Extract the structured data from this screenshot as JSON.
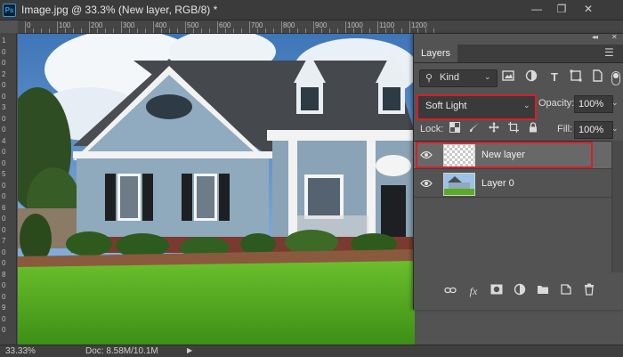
{
  "document": {
    "title": "Image.jpg @ 33.3% (New layer, RGB/8) *",
    "ps_logo": "Ps"
  },
  "window": {
    "minimize": "—",
    "restore": "❐",
    "close": "✕"
  },
  "ruler": {
    "horizontal_labels": [
      "0",
      "100",
      "200",
      "300",
      "400",
      "500",
      "600",
      "700",
      "800",
      "900",
      "1000",
      "1100",
      "1200"
    ],
    "vertical_labels": [
      "1",
      "0",
      "0",
      "2",
      "0",
      "0",
      "3",
      "0",
      "0",
      "4",
      "0",
      "0",
      "5",
      "0",
      "0",
      "6",
      "0",
      "0",
      "7",
      "0",
      "0",
      "8",
      "0",
      "0",
      "9",
      "0",
      "0"
    ]
  },
  "status": {
    "zoom": "33.33%",
    "doc": "Doc: 8.58M/10.1M",
    "arrow": "▶"
  },
  "layers_panel": {
    "collapse_icon": "◂◂",
    "close_icon": "✕",
    "tab_label": "Layers",
    "menu_icon": "☰",
    "filter": {
      "search_icon": "⚲",
      "kind_label": "Kind",
      "chevron": "⌄",
      "icons": [
        "pixel-filter-icon",
        "adjustment-filter-icon",
        "type-filter-icon",
        "shape-filter-icon",
        "smart-object-filter-icon"
      ]
    },
    "blend_mode": "Soft Light",
    "opacity_label": "Opacity:",
    "opacity_value": "100%",
    "lock_label": "Lock:",
    "fill_label": "Fill:",
    "fill_value": "100%",
    "layers": [
      {
        "name": "New layer",
        "visible": true,
        "selected": true
      },
      {
        "name": "Layer 0",
        "visible": true,
        "selected": false
      }
    ],
    "highlight_color": "#d51f2a"
  }
}
